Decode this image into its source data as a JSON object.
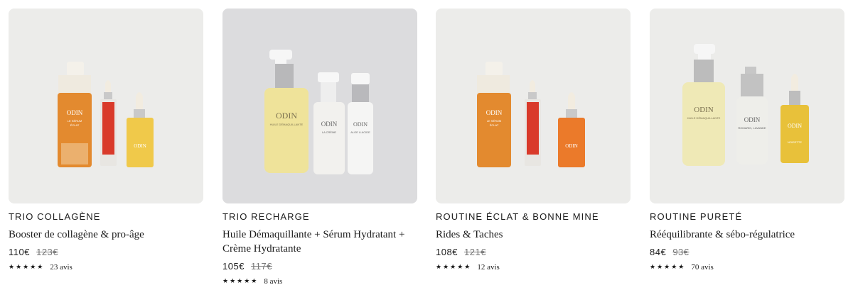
{
  "products": [
    {
      "brand": "ODIN",
      "title": "TRIO COLLAGÈNE",
      "subtitle": "Booster de collagène & pro-âge",
      "price": "110€",
      "old_price": "123€",
      "stars": "★★★★★",
      "reviews": "23 avis",
      "labels": [
        "ODIN",
        "LE SÉRUM",
        "ÉCLAT",
        "ODIN"
      ],
      "bg_color": "#ececea"
    },
    {
      "brand": "ODIN",
      "title": "TRIO RECHARGE",
      "subtitle": "Huile Démaquillante + Sérum Hydratant + Crème Hydratante",
      "price": "105€",
      "old_price": "117€",
      "stars": "★★★★★",
      "reviews": "8 avis",
      "labels": [
        "ODIN",
        "HUILE DÉMAQUILLANTE",
        "ODIN",
        "LA CRÈME",
        "ODIN",
        "ALOE & ACIDE"
      ],
      "bg_color": "#dcdcde"
    },
    {
      "brand": "ODIN",
      "title": "ROUTINE ÉCLAT & BONNE MINE",
      "subtitle": "Rides & Taches",
      "price": "108€",
      "old_price": "121€",
      "stars": "★★★★★",
      "reviews": "12 avis",
      "labels": [
        "ODIN",
        "LE SÉRUM",
        "ÉCLAT",
        "ODIN"
      ],
      "bg_color": "#ececea"
    },
    {
      "brand": "ODIN",
      "title": "ROUTINE PURETÉ",
      "subtitle": "Rééquilibrante & sébo-régulatrice",
      "price": "84€",
      "old_price": "93€",
      "stars": "★★★★★",
      "reviews": "70 avis",
      "labels": [
        "ODIN",
        "HUILE DÉMAQUILLANTE",
        "ODIN",
        "ROMARIN, LAVANDE",
        "ODIN",
        "NOISETTE"
      ],
      "bg_color": "#ececea"
    }
  ]
}
